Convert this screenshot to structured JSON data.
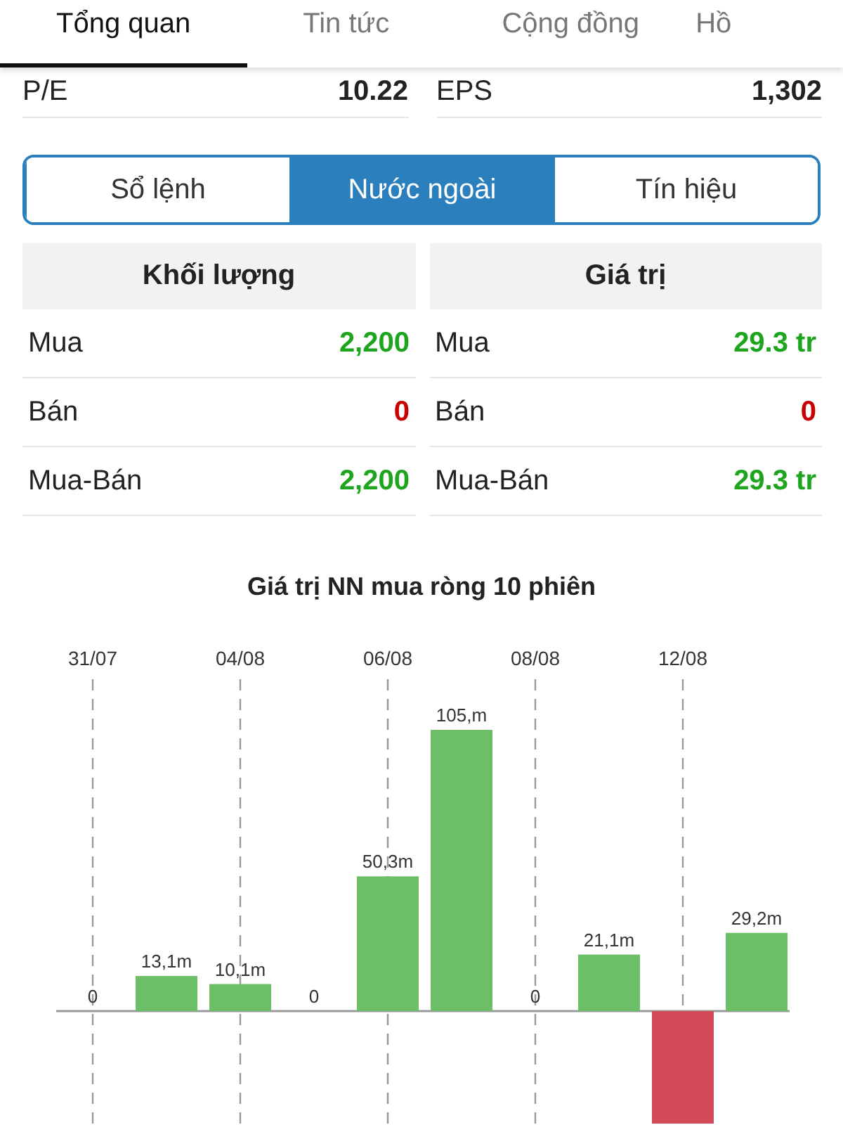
{
  "tabs": [
    {
      "label": "Tổng quan",
      "selected": true
    },
    {
      "label": "Tin tức",
      "selected": false
    },
    {
      "label": "Cộng đồng",
      "selected": false
    },
    {
      "label": "Hồ",
      "selected": false
    }
  ],
  "ratios": [
    {
      "label": "P/E",
      "value": "10.22"
    },
    {
      "label": "EPS",
      "value": "1,302"
    }
  ],
  "segments": [
    {
      "label": "Sổ lệnh",
      "selected": false
    },
    {
      "label": "Nước ngoài",
      "selected": true
    },
    {
      "label": "Tín hiệu",
      "selected": false
    }
  ],
  "tables": [
    {
      "header": "Khối lượng",
      "rows": [
        {
          "label": "Mua",
          "value": "2,200",
          "color": "#1ea51e"
        },
        {
          "label": "Bán",
          "value": "0",
          "color": "#c80000"
        },
        {
          "label": "Mua-Bán",
          "value": "2,200",
          "color": "#1ea51e"
        }
      ]
    },
    {
      "header": "Giá trị",
      "rows": [
        {
          "label": "Mua",
          "value": "29.3 tr",
          "color": "#1ea51e"
        },
        {
          "label": "Bán",
          "value": "0",
          "color": "#c80000"
        },
        {
          "label": "Mua-Bán",
          "value": "29.3 tr",
          "color": "#1ea51e"
        }
      ]
    }
  ],
  "chart": {
    "chart_data": {
      "type": "bar",
      "title": "Giá trị NN mua ròng 10 phiên",
      "grid": true,
      "categories": [
        "31/07",
        null,
        "04/08",
        null,
        "06/08",
        null,
        "08/08",
        null,
        "12/08",
        null
      ],
      "values": [
        0,
        13.1,
        10.1,
        0,
        50.3,
        105,
        0,
        21.1,
        -42,
        29.2
      ],
      "value_labels": [
        "0",
        "13,1m",
        "10,1m",
        "0",
        "50,3m",
        "105,m",
        "0",
        "21,1m",
        null,
        "29,2m"
      ]
    }
  }
}
